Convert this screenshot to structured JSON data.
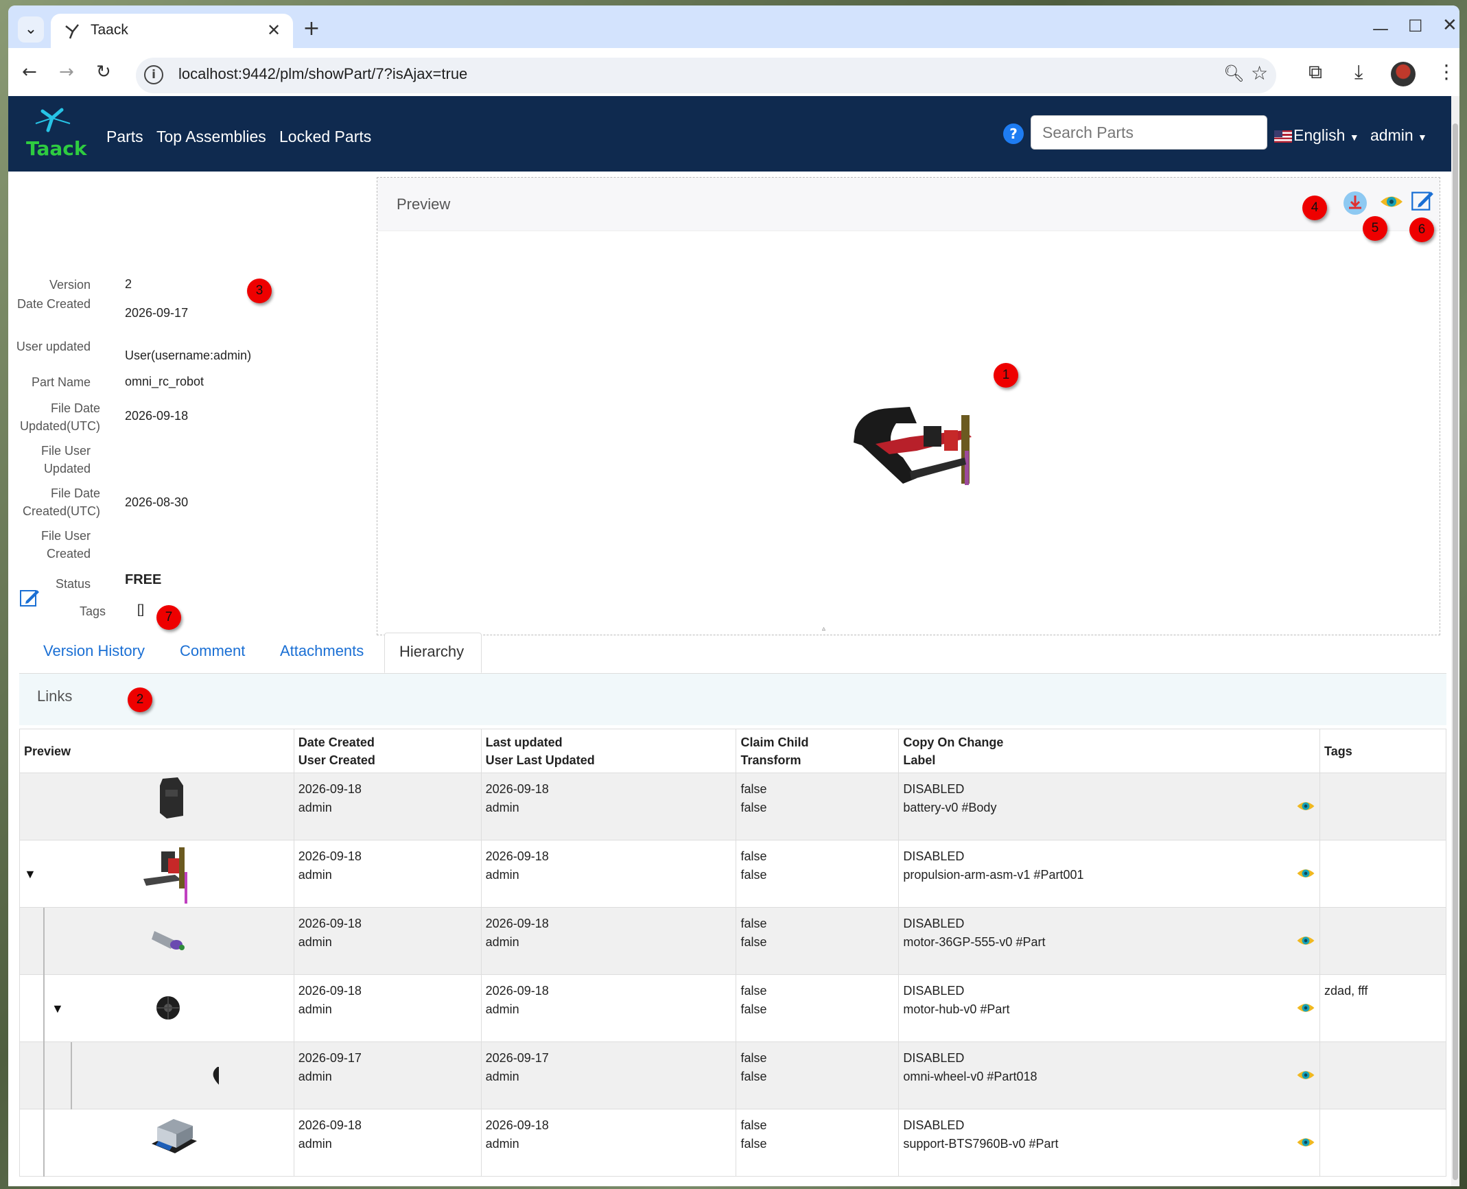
{
  "browser": {
    "tab_title": "Taack",
    "url": "localhost:9442/plm/showPart/7?isAjax=true"
  },
  "nav": {
    "brand": "Taack",
    "links": [
      "Parts",
      "Top Assemblies",
      "Locked Parts"
    ],
    "search_placeholder": "Search Parts",
    "language": "English",
    "user": "admin"
  },
  "meta": {
    "version_label": "Version",
    "version": "2",
    "date_created_label": "Date Created",
    "date_created": "2026-09-17",
    "user_updated_label": "User updated",
    "user_updated": "User(username:admin)",
    "part_name_label": "Part Name",
    "part_name": "omni_rc_robot",
    "file_date_updated_label": "File Date Updated(UTC)",
    "file_date_updated": "2026-09-18",
    "file_user_updated_label": "File User Updated",
    "file_user_updated": "",
    "file_date_created_label": "File Date Created(UTC)",
    "file_date_created": "2026-08-30",
    "file_user_created_label": "File User Created",
    "file_user_created": "",
    "status_label": "Status",
    "status": "FREE",
    "tags_label": "Tags",
    "tags": "[]"
  },
  "preview": {
    "title": "Preview"
  },
  "badges": [
    "1",
    "2",
    "3",
    "4",
    "5",
    "6",
    "7"
  ],
  "tabs": [
    "Version History",
    "Comment",
    "Attachments",
    "Hierarchy"
  ],
  "links": {
    "title": "Links",
    "columns": {
      "preview": "Preview",
      "date_created": "Date Created",
      "user_created": "User Created",
      "last_updated": "Last updated",
      "user_last_updated": "User Last Updated",
      "claim_child": "Claim Child",
      "transform": "Transform",
      "copy_on_change": "Copy On Change",
      "label": "Label",
      "tags": "Tags"
    },
    "rows": [
      {
        "date_created": "2026-09-18",
        "user_created": "admin",
        "last_updated": "2026-09-18",
        "user_last_updated": "admin",
        "claim_child": "false",
        "transform": "false",
        "copy_on_change": "DISABLED",
        "label": "battery-v0 #Body",
        "tags": ""
      },
      {
        "date_created": "2026-09-18",
        "user_created": "admin",
        "last_updated": "2026-09-18",
        "user_last_updated": "admin",
        "claim_child": "false",
        "transform": "false",
        "copy_on_change": "DISABLED",
        "label": "propulsion-arm-asm-v1 #Part001",
        "tags": ""
      },
      {
        "date_created": "2026-09-18",
        "user_created": "admin",
        "last_updated": "2026-09-18",
        "user_last_updated": "admin",
        "claim_child": "false",
        "transform": "false",
        "copy_on_change": "DISABLED",
        "label": "motor-36GP-555-v0 #Part",
        "tags": ""
      },
      {
        "date_created": "2026-09-18",
        "user_created": "admin",
        "last_updated": "2026-09-18",
        "user_last_updated": "admin",
        "claim_child": "false",
        "transform": "false",
        "copy_on_change": "DISABLED",
        "label": "motor-hub-v0 #Part",
        "tags": "zdad, fff"
      },
      {
        "date_created": "2026-09-17",
        "user_created": "admin",
        "last_updated": "2026-09-17",
        "user_last_updated": "admin",
        "claim_child": "false",
        "transform": "false",
        "copy_on_change": "DISABLED",
        "label": "omni-wheel-v0 #Part018",
        "tags": ""
      },
      {
        "date_created": "2026-09-18",
        "user_created": "admin",
        "last_updated": "2026-09-18",
        "user_last_updated": "admin",
        "claim_child": "false",
        "transform": "false",
        "copy_on_change": "DISABLED",
        "label": "support-BTS7960B-v0 #Part",
        "tags": ""
      }
    ]
  },
  "colors": {
    "navbar": "#0f2a4f",
    "link": "#1a6fd4",
    "badge": "#ee0000"
  },
  "icons": [
    "chevron-down-icon",
    "close-icon",
    "plus-icon",
    "back-icon",
    "forward-icon",
    "reload-icon",
    "info-icon",
    "zoom-icon",
    "star-icon",
    "extensions-icon",
    "download-icon",
    "menu-icon",
    "help-icon",
    "edit-icon",
    "eye-icon",
    "download-file-icon"
  ]
}
